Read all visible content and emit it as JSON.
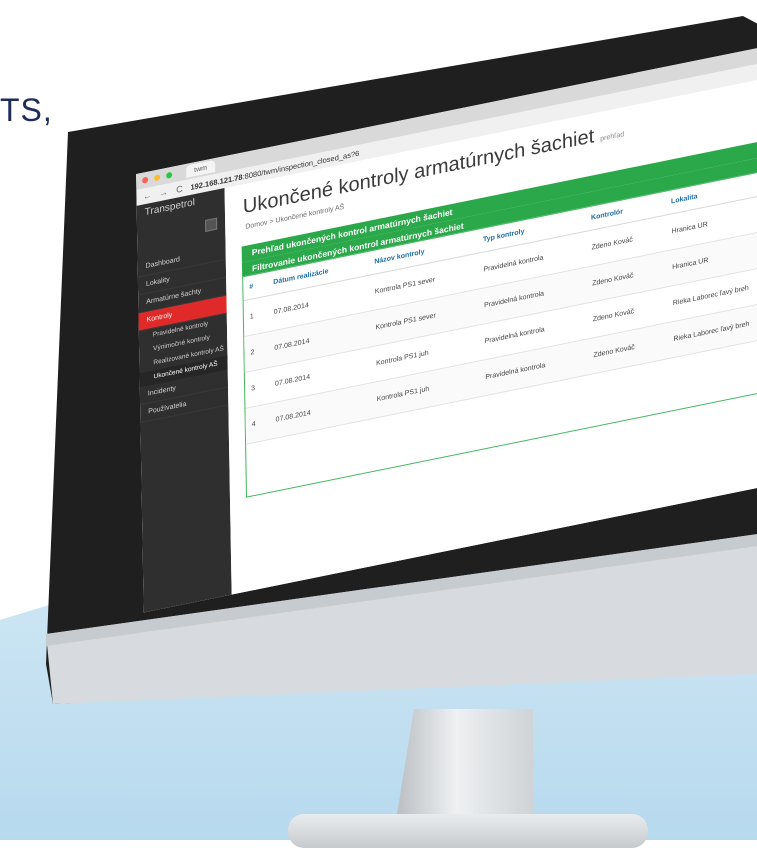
{
  "headline": "TS,",
  "browser": {
    "tab_title": "twm",
    "url_bold": "192.168.121.78",
    "url_rest": ":8080/twm/inspection_closed_as?6"
  },
  "app": {
    "brand": "Transpetrol",
    "page_title": "Ukončené kontroly armatúrnych šachiet",
    "page_subtitle": "prehľad",
    "breadcrumb": "Domov > Ukončené kontroly AŠ",
    "bars": {
      "overview": "Prehľad ukončených kontrol armatúrnych šachiet",
      "filter": "Filtrovanie ukončených kontrol armatúrnych šachiet"
    },
    "sidebar": {
      "items": [
        {
          "label": "Dashboard",
          "active": false
        },
        {
          "label": "Lokality",
          "active": false
        },
        {
          "label": "Armatúrne šachty",
          "active": false
        },
        {
          "label": "Kontroly",
          "active": true
        }
      ],
      "subitems": [
        {
          "label": "Pravidelné kontroly",
          "active": false
        },
        {
          "label": "Výnimočné kontroly",
          "active": false
        },
        {
          "label": "Realizované kontroly AŠ",
          "active": false
        },
        {
          "label": "Ukončené kontroly AŠ",
          "active": true
        }
      ],
      "items_after": [
        {
          "label": "Incidenty",
          "active": false
        },
        {
          "label": "Používatelia",
          "active": false
        }
      ]
    },
    "table": {
      "headers": [
        "#",
        "Dátum realizácie",
        "Názov kontroly",
        "Typ kontroly",
        "Kontrolór",
        "Lokalita"
      ],
      "rows": [
        [
          "1",
          "07.08.2014",
          "Kontrola PS1 sever",
          "Pravidelná kontrola",
          "Zdeno Kováč",
          "Hranica UR"
        ],
        [
          "2",
          "07.08.2014",
          "Kontrola PS1 sever",
          "Pravidelná kontrola",
          "Zdeno Kováč",
          "Hranica UR"
        ],
        [
          "3",
          "07.08.2014",
          "Kontrola PS1 juh",
          "Pravidelná kontrola",
          "Zdeno Kováč",
          "Rieka Laborec ľavý breh"
        ],
        [
          "4",
          "07.08.2014",
          "Kontrola PS1 juh",
          "Pravidelná kontrola",
          "Zdeno Kováč",
          "Rieka Laborec ľavý breh"
        ]
      ]
    }
  }
}
